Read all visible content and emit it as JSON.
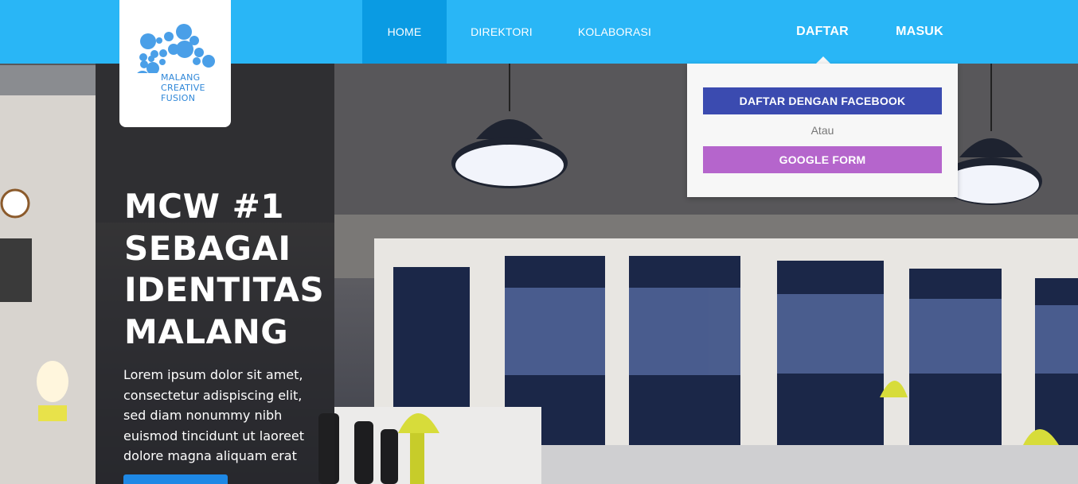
{
  "brand": {
    "logo_lines": [
      "MALANG",
      "CREATIVE",
      "FUSION"
    ],
    "logo_color": "#2f87d8"
  },
  "nav": {
    "items": [
      {
        "label": "HOME",
        "active": true
      },
      {
        "label": "DIREKTORI",
        "active": false
      },
      {
        "label": "KOLABORASI",
        "active": false
      }
    ],
    "daftar_label": "DAFTAR",
    "masuk_label": "MASUK",
    "bar_color": "#29b6f6",
    "active_color": "#0a9be3"
  },
  "hero": {
    "headline_lines": [
      "MCW #1",
      "SEBAGAI",
      "IDENTITAS",
      "MALANG"
    ],
    "body_lines": [
      "Lorem ipsum dolor sit amet,",
      "consectetur adispiscing elit,",
      "sed diam nonummy nibh",
      "euismod tincidunt ut laoreet",
      "dolore magna aliquam erat"
    ]
  },
  "dropdown": {
    "facebook_label": "DAFTAR DENGAN FACEBOOK",
    "or_label": "Atau",
    "google_label": "GOOGLE FORM",
    "facebook_color": "#3b4bb0",
    "google_color": "#b565cc"
  }
}
